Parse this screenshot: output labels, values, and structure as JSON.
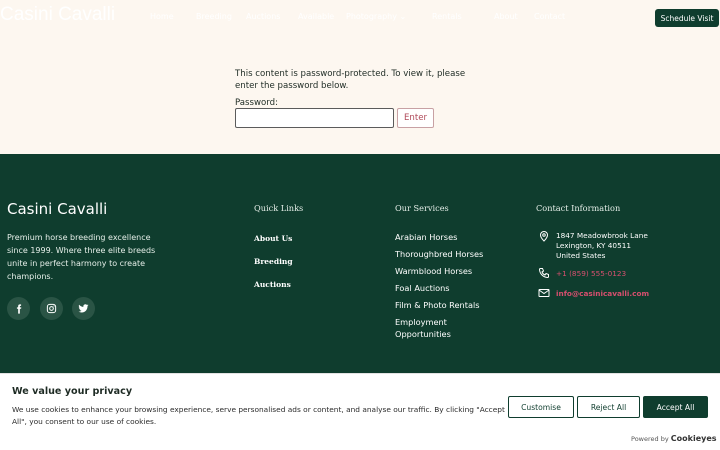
{
  "header": {
    "logo": "Casini Cavalli",
    "nav": [
      "Home",
      "Breeding",
      "Auctions",
      "Available",
      "Photography ⌄",
      "Rentals",
      "About",
      "Contact"
    ],
    "schedule_label": "Schedule Visit"
  },
  "password_form": {
    "message": "This content is password-protected. To view it, please enter the password below.",
    "label": "Password:",
    "value": "",
    "enter_label": "Enter"
  },
  "footer": {
    "brand": "Casini Cavalli",
    "description": "Premium horse breeding excellence since 1999. Where three elite breeds unite in perfect harmony to create champions.",
    "social_icons": [
      "facebook-icon",
      "instagram-icon",
      "twitter-icon"
    ],
    "quick_links_heading": "Quick Links",
    "quick_links": [
      "About Us",
      "Breeding",
      "Auctions"
    ],
    "services_heading": "Our Services",
    "services": [
      "Arabian Horses",
      "Thoroughbred Horses",
      "Warmblood Horses",
      "Foal Auctions",
      "Film & Photo Rentals",
      "Employment Opportunities"
    ],
    "contact_heading": "Contact Information",
    "address": "1847 Meadowbrook Lane\nLexington, KY 40511\nUnited States",
    "phone": "+1 (859) 555-0123",
    "email": "info@casinicavalli.com"
  },
  "cookie_banner": {
    "title": "We value your privacy",
    "text": "We use cookies to enhance your browsing experience, serve personalised ads or content, and analyse our traffic. By clicking \"Accept All\", you consent to our use of cookies.",
    "customise_label": "Customise",
    "reject_label": "Reject All",
    "accept_label": "Accept All",
    "powered_by": "Powered by",
    "powered_brand": "Cookieyes"
  },
  "colors": {
    "brand_green": "#0f3d2e",
    "page_bg": "#fdf7f0",
    "accent_pink": "#d64f6e"
  }
}
